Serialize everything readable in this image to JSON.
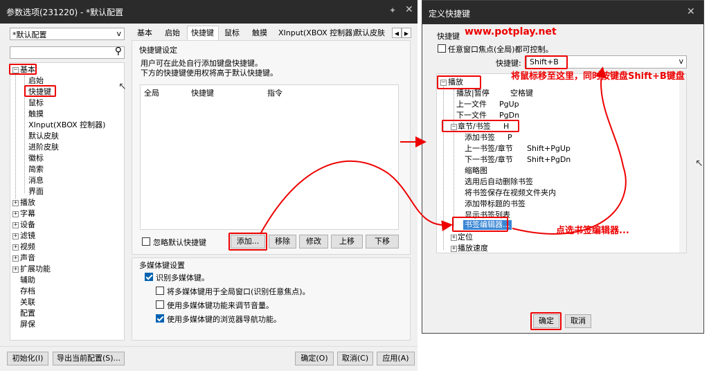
{
  "left_window": {
    "title": "参数选项(231220) - *默认配置",
    "profile_select": "*默认配置",
    "tabs": [
      "基本",
      "启始",
      "快捷键",
      "鼠标",
      "触摸",
      "XInput(XBOX 控制器)",
      "默认皮肤"
    ],
    "tree": [
      {
        "label": "基本",
        "expanded": true
      },
      {
        "label": "启始"
      },
      {
        "label": "快捷键"
      },
      {
        "label": "鼠标"
      },
      {
        "label": "触摸"
      },
      {
        "label": "XInput(XBOX 控制器)"
      },
      {
        "label": "默认皮肤"
      },
      {
        "label": "进阶皮肤"
      },
      {
        "label": "徽标"
      },
      {
        "label": "简索"
      },
      {
        "label": "消息"
      },
      {
        "label": "界面"
      },
      {
        "label": "播放"
      },
      {
        "label": "字幕"
      },
      {
        "label": "设备"
      },
      {
        "label": "滤镜"
      },
      {
        "label": "视频"
      },
      {
        "label": "声音"
      },
      {
        "label": "扩展功能"
      },
      {
        "label": "辅助"
      },
      {
        "label": "存档"
      },
      {
        "label": "关联"
      },
      {
        "label": "配置"
      },
      {
        "label": "屏保"
      }
    ],
    "hotkey_group": {
      "title": "快捷键设定",
      "desc1": "用户可在此处自行添加键盘快捷键。",
      "desc2": "下方的快捷键使用权将高于默认快捷键。",
      "columns": [
        "全局",
        "快捷键",
        "指令"
      ],
      "ignore_default": "忽略默认快捷键",
      "buttons": [
        "添加...",
        "移除",
        "修改",
        "上移",
        "下移"
      ]
    },
    "media_group": {
      "title": "多媒体键设置",
      "recognize": "识别多媒体键。",
      "opt1": "将多媒体键用于全局窗口(识别任意焦点)。",
      "opt2": "使用多媒体键功能来调节音量。",
      "opt3": "使用多媒体键的浏览器导航功能。"
    },
    "bottom_buttons": [
      "初始化(I)",
      "导出当前配置(S)...",
      "确定(O)",
      "取消(C)",
      "应用(A)"
    ]
  },
  "right_window": {
    "title": "定义快捷键",
    "group_label": "快捷键",
    "watermark": "www.potplay.net",
    "any_focus": "任意窗口焦点(全局)都可控制。",
    "key_label": "快捷键:",
    "key_value": "Shift+B",
    "tree": [
      {
        "label": "播放",
        "key": ""
      },
      {
        "label": "播放|暂停",
        "key": "空格键"
      },
      {
        "label": "上一文件",
        "key": "PgUp"
      },
      {
        "label": "下一文件",
        "key": "PgDn"
      },
      {
        "label": "章节/书签",
        "key": "H"
      },
      {
        "label": "添加书签",
        "key": "P"
      },
      {
        "label": "上一书签/章节",
        "key": "Shift+PgUp"
      },
      {
        "label": "下一书签/章节",
        "key": "Shift+PgDn"
      },
      {
        "label": "缩略图",
        "key": ""
      },
      {
        "label": "选用后自动删除书签",
        "key": ""
      },
      {
        "label": "将书签保存在视频文件夹内",
        "key": ""
      },
      {
        "label": "添加带标题的书签",
        "key": ""
      },
      {
        "label": "显示书签列表",
        "key": ""
      },
      {
        "label": "书签编辑器...",
        "key": ""
      },
      {
        "label": "定位",
        "key": ""
      },
      {
        "label": "播放速度",
        "key": ""
      }
    ],
    "ok": "确定",
    "cancel": "取消"
  },
  "annotations": {
    "move_mouse": "将鼠标移至这里，同时按键盘Shift+B键盘",
    "click_editor": "点选书签编辑器..."
  }
}
